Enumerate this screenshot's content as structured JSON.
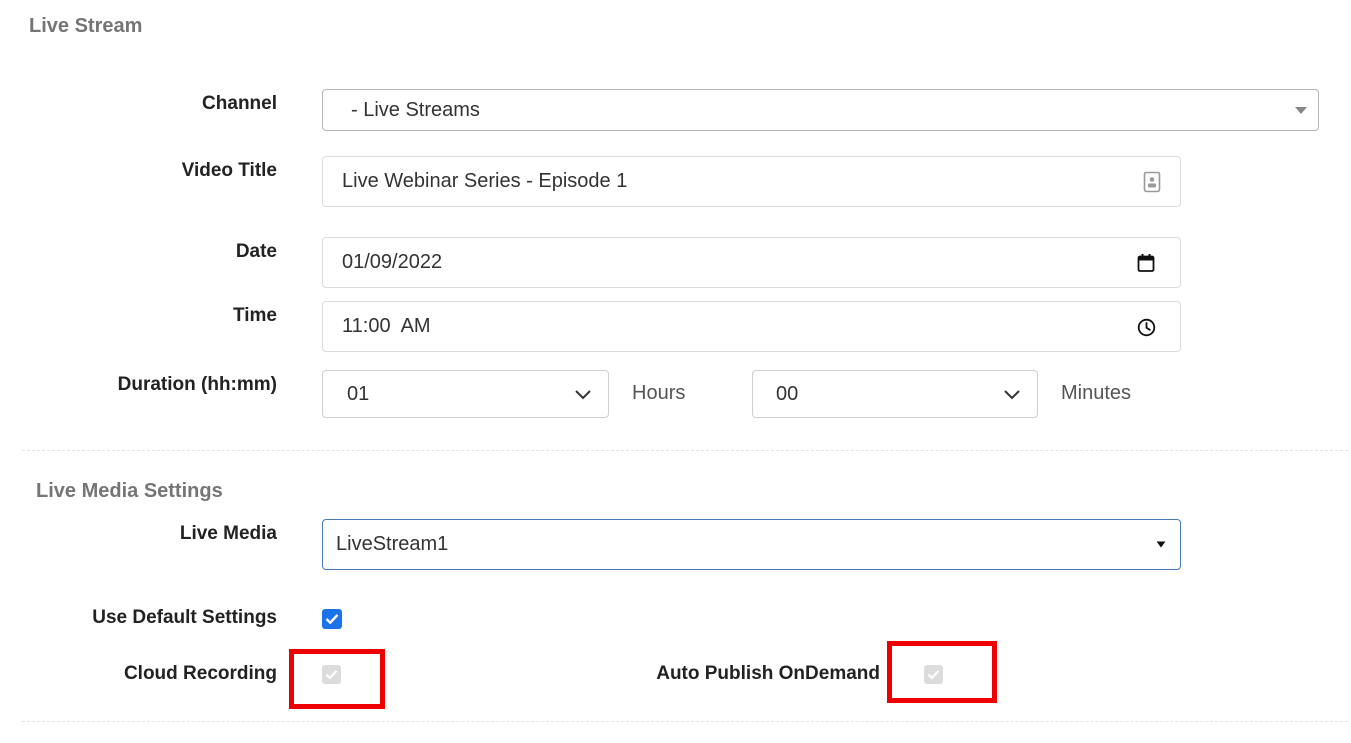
{
  "live_stream": {
    "title": "Live Stream",
    "channel": {
      "label": "Channel",
      "value": "-  Live Streams"
    },
    "video_title": {
      "label": "Video Title",
      "value": "Live Webinar Series - Episode 1"
    },
    "date": {
      "label": "Date",
      "value": "01/09/2022"
    },
    "time": {
      "label": "Time",
      "value": "11:00  AM"
    },
    "duration": {
      "label": "Duration (hh:mm)",
      "hours_value": "01",
      "hours_unit": "Hours",
      "minutes_value": "00",
      "minutes_unit": "Minutes"
    }
  },
  "live_media_settings": {
    "title": "Live Media Settings",
    "live_media": {
      "label": "Live Media",
      "value": "LiveStream1"
    },
    "use_default_settings": {
      "label": "Use Default Settings",
      "checked": true
    },
    "cloud_recording": {
      "label": "Cloud Recording",
      "checked": true,
      "disabled": true
    },
    "auto_publish_ondemand": {
      "label": "Auto Publish OnDemand",
      "checked": true,
      "disabled": true
    }
  },
  "colors": {
    "checkbox_checked": "#1a73e8",
    "checkbox_disabled": "#dcdcdc",
    "highlight_box": "#ee0000",
    "focus_border": "#4a7bb7"
  }
}
